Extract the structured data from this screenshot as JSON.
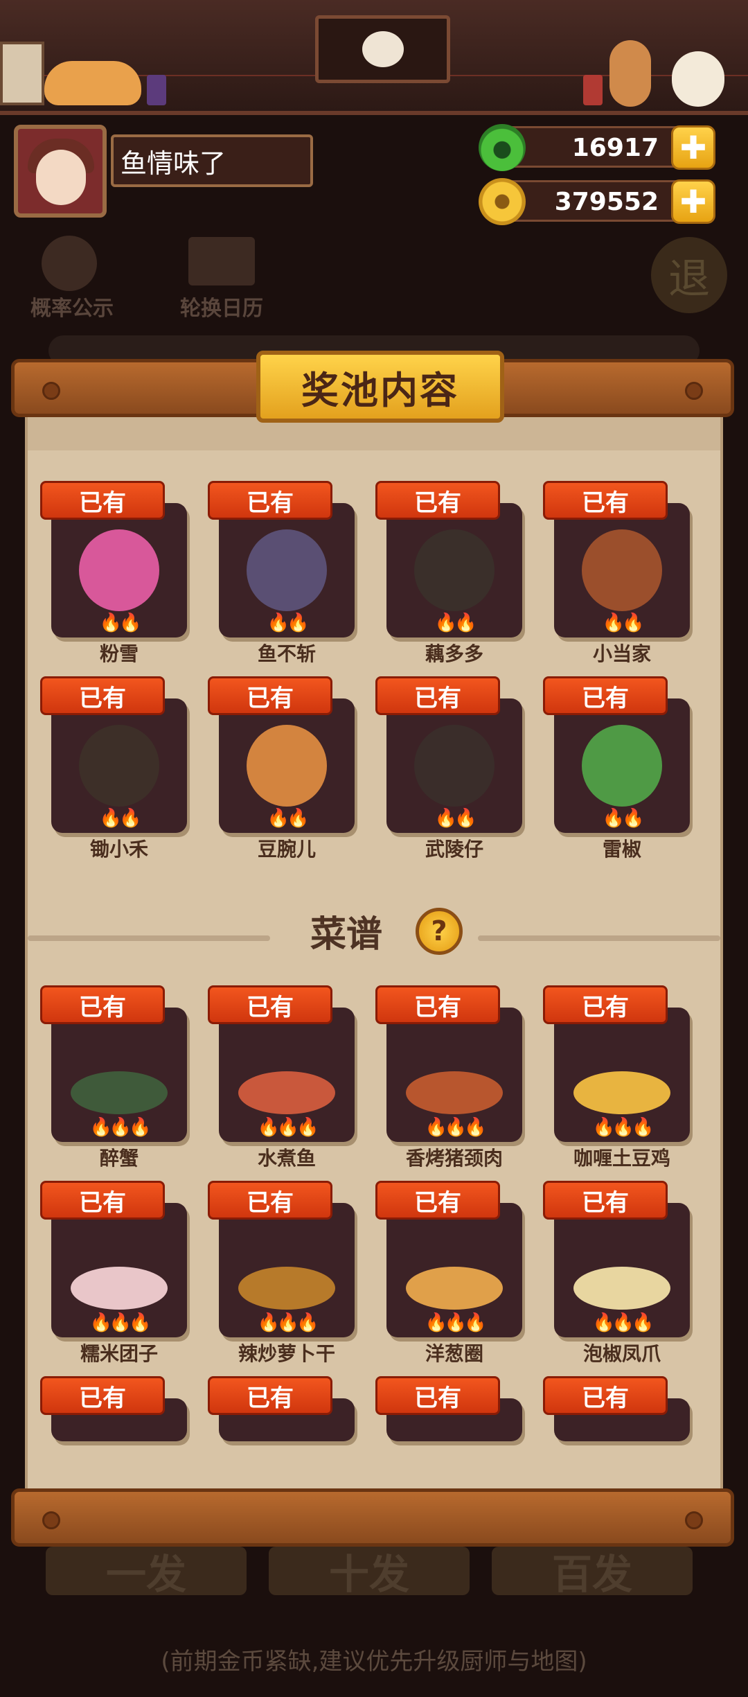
{
  "player": {
    "name": "鱼情味了"
  },
  "resources": {
    "jade": "16917",
    "coins": "379552",
    "add_label": "✚"
  },
  "background": {
    "odds_label": "概率公示",
    "calendar_label": "轮换日历",
    "exit_label": "退",
    "draw_once": "一发",
    "draw_ten": "十发",
    "draw_hundred": "百发",
    "hint": "(前期金币紧缺,建议优先升级厨师与地图)"
  },
  "pool": {
    "title": "奖池内容",
    "owned_label": "已有",
    "chefs": [
      {
        "name": "粉雪",
        "color": "#d8589a"
      },
      {
        "name": "鱼不斩",
        "color": "#5a4f73"
      },
      {
        "name": "藕多多",
        "color": "#3a2f2a"
      },
      {
        "name": "小当家",
        "color": "#9b4f2c"
      },
      {
        "name": "锄小禾",
        "color": "#3d2f28"
      },
      {
        "name": "豆腕儿",
        "color": "#d3843f"
      },
      {
        "name": "武陵仔",
        "color": "#3a2d2a"
      },
      {
        "name": "雷椒",
        "color": "#4f9a45"
      }
    ],
    "recipes_title": "菜谱",
    "recipes": [
      {
        "name": "醉蟹",
        "color": "#3f5a3a"
      },
      {
        "name": "水煮鱼",
        "color": "#c9583c"
      },
      {
        "name": "香烤猪颈肉",
        "color": "#b8562e"
      },
      {
        "name": "咖喱土豆鸡",
        "color": "#e8b440"
      },
      {
        "name": "糯米团子",
        "color": "#e9c6c9"
      },
      {
        "name": "辣炒萝卜干",
        "color": "#b77a2a"
      },
      {
        "name": "洋葱圈",
        "color": "#e0a04a"
      },
      {
        "name": "泡椒凤爪",
        "color": "#e8d6a0"
      },
      {
        "name": ""
      },
      {
        "name": ""
      },
      {
        "name": ""
      },
      {
        "name": ""
      }
    ]
  }
}
